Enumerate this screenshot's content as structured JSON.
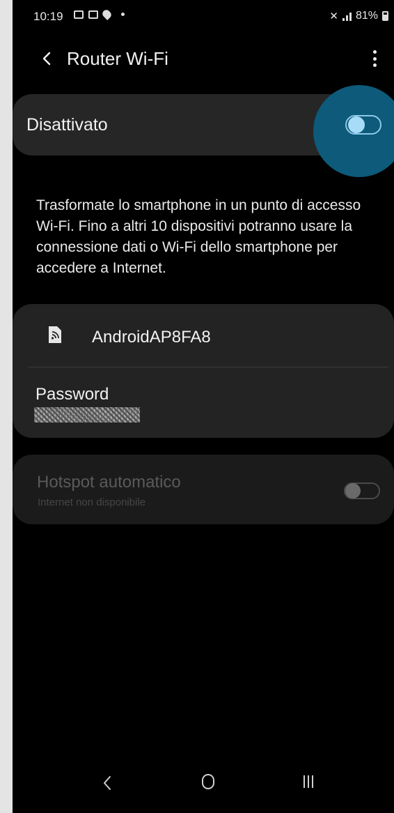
{
  "status_bar": {
    "time": "10:19",
    "battery": "81%",
    "icons_left": [
      "gallery-icon",
      "image-icon",
      "location-icon",
      "dot-icon"
    ],
    "icons_right": [
      "mute-icon",
      "signal-icon",
      "battery-icon"
    ]
  },
  "app_bar": {
    "title": "Router Wi-Fi",
    "back_icon": "chevron-left-icon",
    "more_icon": "more-vertical-icon"
  },
  "master_toggle": {
    "label": "Disattivato",
    "state": "off",
    "accent_color": "#a6dcf7",
    "ripple_color": "#0d5a7a"
  },
  "description": "Trasformate lo smartphone in un punto di accesso Wi-Fi. Fino a altri 10 dispositivi potranno usare la connessione dati o Wi-Fi dello smartphone per accedere a Internet.",
  "network": {
    "ssid": "AndroidAP8FA8",
    "ssid_icon": "hotspot-device-icon",
    "password_label": "Password"
  },
  "auto_hotspot": {
    "title": "Hotspot automatico",
    "subtitle": "Internet non disponibile",
    "state": "off",
    "enabled": false
  },
  "nav_bar": {
    "icons": [
      "nav-back-icon",
      "nav-home-icon",
      "nav-recents-icon"
    ]
  }
}
